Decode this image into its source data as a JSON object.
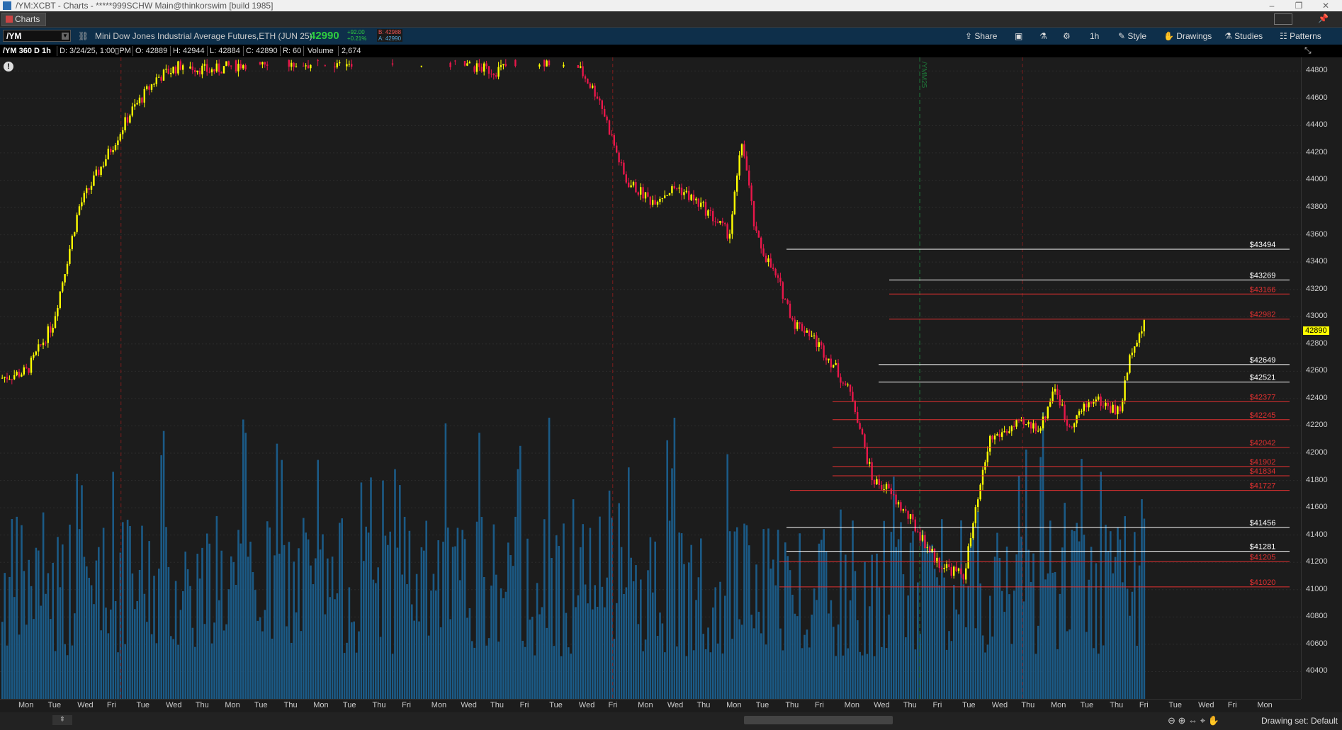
{
  "window": {
    "title": "/YM:XCBT - Charts - *****999SCHW Main@thinkorswim [build 1985]",
    "controls": [
      "–",
      "❐",
      "✕"
    ]
  },
  "tab": {
    "label": "Charts"
  },
  "toolbar": {
    "symbol": "/YM",
    "description": "Mini Dow Jones Industrial Average Futures,ETH (JUN 25)",
    "last_price": "42990",
    "net_change": "+92.00",
    "pct_change": "+0.21%",
    "bid": "B: 42988",
    "ask": "A: 42990",
    "buttons": [
      "Share",
      "1h",
      "Style",
      "Drawings",
      "Studies",
      "Patterns"
    ]
  },
  "info": {
    "study_name": "/YM 360 D 1h",
    "date": "D: 3/24/25, 1:00▯PM",
    "open": "O: 42889",
    "high": "H: 42944",
    "low": "L: 42884",
    "close": "C: 42890",
    "range": "R: 60",
    "volume_label": "Volume",
    "volume_value": "2,674"
  },
  "colors": {
    "up_candle": "#ffff00",
    "down_candle": "#e8174a",
    "volume": "#1b5a86",
    "support_line": "#ffffff",
    "resistance_line": "#e03030",
    "price_tag": "#ffff00"
  },
  "chart_data": {
    "type": "candlestick",
    "interval": "1h",
    "ylim": [
      40200,
      44900
    ],
    "yticks": [
      40400,
      40600,
      40800,
      41000,
      41200,
      41400,
      41600,
      41800,
      42000,
      42200,
      42400,
      42600,
      42800,
      43000,
      43200,
      43400,
      43600,
      43800,
      44000,
      44200,
      44400,
      44600,
      44800
    ],
    "x_labels": [
      "Mon",
      "Tue",
      "Wed",
      "Fri",
      "Tue",
      "Wed",
      "Thu",
      "Mon",
      "Tue",
      "Thu",
      "Mon",
      "Tue",
      "Thu",
      "Fri",
      "Mon",
      "Wed",
      "Thu",
      "Fri",
      "Tue",
      "Wed",
      "Fri",
      "Mon",
      "Wed",
      "Thu",
      "Mon",
      "Tue",
      "Thu",
      "Fri",
      "Mon",
      "Wed",
      "Thu",
      "Fri",
      "Tue",
      "Wed",
      "Thu",
      "Mon",
      "Tue",
      "Thu",
      "Fri",
      "Tue",
      "Wed",
      "Fri",
      "Mon"
    ],
    "current_price": "42890",
    "rollover_label": "/YMM25",
    "levels": [
      {
        "label": "$43494",
        "value": 43494,
        "color": "white"
      },
      {
        "label": "$43269",
        "value": 43269,
        "color": "white"
      },
      {
        "label": "$43166",
        "value": 43166,
        "color": "red"
      },
      {
        "label": "$42982",
        "value": 42982,
        "color": "red"
      },
      {
        "label": "$42649",
        "value": 42649,
        "color": "white"
      },
      {
        "label": "$42521",
        "value": 42521,
        "color": "white"
      },
      {
        "label": "$42377",
        "value": 42377,
        "color": "red"
      },
      {
        "label": "$42245",
        "value": 42245,
        "color": "red"
      },
      {
        "label": "$42042",
        "value": 42042,
        "color": "red"
      },
      {
        "label": "$41902",
        "value": 41902,
        "color": "red"
      },
      {
        "label": "$41834",
        "value": 41834,
        "color": "red"
      },
      {
        "label": "$41727",
        "value": 41727,
        "color": "red"
      },
      {
        "label": "$41456",
        "value": 41456,
        "color": "white"
      },
      {
        "label": "$41281",
        "value": 41281,
        "color": "white"
      },
      {
        "label": "$41205",
        "value": 41205,
        "color": "red"
      },
      {
        "label": "$41020",
        "value": 41020,
        "color": "red"
      }
    ],
    "price_path": [
      [
        0,
        42550
      ],
      [
        0.02,
        42600
      ],
      [
        0.04,
        42950
      ],
      [
        0.06,
        43800
      ],
      [
        0.08,
        44150
      ],
      [
        0.1,
        44500
      ],
      [
        0.12,
        44750
      ],
      [
        0.14,
        44850
      ],
      [
        0.16,
        44800
      ],
      [
        0.2,
        44880
      ],
      [
        0.24,
        44850
      ],
      [
        0.28,
        44880
      ],
      [
        0.3,
        44880
      ],
      [
        0.34,
        44870
      ],
      [
        0.38,
        44800
      ],
      [
        0.4,
        44880
      ],
      [
        0.42,
        44870
      ],
      [
        0.44,
        44880
      ],
      [
        0.46,
        44600
      ],
      [
        0.48,
        44000
      ],
      [
        0.5,
        43850
      ],
      [
        0.52,
        43950
      ],
      [
        0.54,
        43800
      ],
      [
        0.56,
        43600
      ],
      [
        0.57,
        44300
      ],
      [
        0.58,
        43600
      ],
      [
        0.6,
        43200
      ],
      [
        0.61,
        42950
      ],
      [
        0.62,
        42900
      ],
      [
        0.64,
        42650
      ],
      [
        0.655,
        42400
      ],
      [
        0.67,
        41800
      ],
      [
        0.68,
        41750
      ],
      [
        0.7,
        41500
      ],
      [
        0.72,
        41200
      ],
      [
        0.74,
        41100
      ],
      [
        0.75,
        41600
      ],
      [
        0.76,
        42100
      ],
      [
        0.78,
        42200
      ],
      [
        0.8,
        42200
      ],
      [
        0.81,
        42500
      ],
      [
        0.82,
        42200
      ],
      [
        0.84,
        42400
      ],
      [
        0.86,
        42300
      ],
      [
        0.87,
        42800
      ],
      [
        0.88,
        42950
      ]
    ]
  },
  "bottom": {
    "drawing_set": "Drawing set: Default",
    "zoom_icons": [
      "zoom-out-icon",
      "zoom-in-icon",
      "fit-icon",
      "crosshair-icon",
      "pan-icon"
    ]
  }
}
